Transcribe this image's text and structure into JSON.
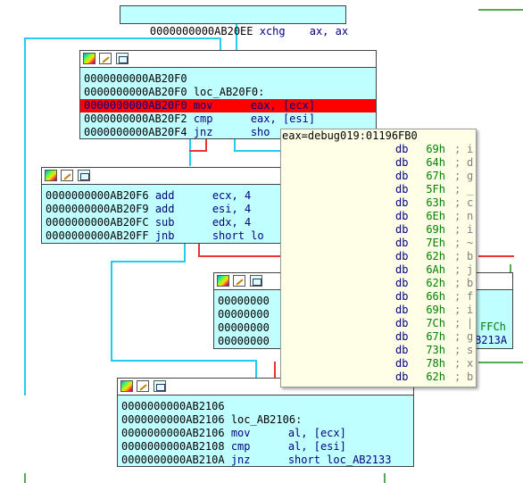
{
  "block_top": {
    "addr": "0000000000AB20EE",
    "mnem": "xchg",
    "ops": "ax, ax"
  },
  "block1": {
    "rows": [
      {
        "addr": "0000000000AB20F0",
        "mnem": "",
        "ops": ""
      },
      {
        "addr": "0000000000AB20F0",
        "mnem": "loc_AB20F0:",
        "ops": ""
      },
      {
        "addr": "0000000000AB20F0",
        "mnem": "mov",
        "ops": "eax, [ecx]"
      },
      {
        "addr": "0000000000AB20F2",
        "mnem": "cmp",
        "ops": "eax, [esi]"
      },
      {
        "addr": "0000000000AB20F4",
        "mnem": "jnz",
        "ops": "sho"
      }
    ]
  },
  "block2": {
    "rows": [
      {
        "addr": "0000000000AB20F6",
        "mnem": "add",
        "ops": "ecx, 4"
      },
      {
        "addr": "0000000000AB20F9",
        "mnem": "add",
        "ops": "esi, 4"
      },
      {
        "addr": "0000000000AB20FC",
        "mnem": "sub",
        "ops": "edx, 4"
      },
      {
        "addr": "0000000000AB20FF",
        "mnem": "jnb",
        "ops": "short lo"
      }
    ]
  },
  "block3": {
    "rows": [
      "00000000",
      "00000000",
      "00000000",
      "00000000"
    ],
    "right_frag_1": "FFCh",
    "right_frag_2": "B213A"
  },
  "block4": {
    "rows": [
      {
        "addr": "0000000000AB2106",
        "mnem": "",
        "ops": ""
      },
      {
        "addr": "0000000000AB2106",
        "mnem": "loc_AB2106:",
        "ops": ""
      },
      {
        "addr": "0000000000AB2106",
        "mnem": "mov",
        "ops": "al, [ecx]"
      },
      {
        "addr": "0000000000AB2108",
        "mnem": "cmp",
        "ops": "al, [esi]"
      },
      {
        "addr": "0000000000AB210A",
        "mnem": "jnz",
        "ops": "short loc_AB2133"
      }
    ]
  },
  "hint": {
    "title": "eax=debug019:01196FB0",
    "rows": [
      {
        "db": "db",
        "hex": "69h",
        "ch": "i"
      },
      {
        "db": "db",
        "hex": "64h",
        "ch": "d"
      },
      {
        "db": "db",
        "hex": "67h",
        "ch": "g"
      },
      {
        "db": "db",
        "hex": "5Fh",
        "ch": "_"
      },
      {
        "db": "db",
        "hex": "63h",
        "ch": "c"
      },
      {
        "db": "db",
        "hex": "6Eh",
        "ch": "n"
      },
      {
        "db": "db",
        "hex": "69h",
        "ch": "i"
      },
      {
        "db": "db",
        "hex": "7Eh",
        "ch": "~"
      },
      {
        "db": "db",
        "hex": "62h",
        "ch": "b"
      },
      {
        "db": "db",
        "hex": "6Ah",
        "ch": "j"
      },
      {
        "db": "db",
        "hex": "62h",
        "ch": "b"
      },
      {
        "db": "db",
        "hex": "66h",
        "ch": "f"
      },
      {
        "db": "db",
        "hex": "69h",
        "ch": "i"
      },
      {
        "db": "db",
        "hex": "7Ch",
        "ch": "|"
      },
      {
        "db": "db",
        "hex": "67h",
        "ch": "g"
      },
      {
        "db": "db",
        "hex": "73h",
        "ch": "s"
      },
      {
        "db": "db",
        "hex": "78h",
        "ch": "x"
      },
      {
        "db": "db",
        "hex": "62h",
        "ch": "b"
      }
    ]
  },
  "colors": {
    "block_bg": "#c0ffff",
    "selection": "#ff0000",
    "edge_true": "#22ccee",
    "edge_false": "#ee3333",
    "edge_green": "#55aa55",
    "hint_bg": "#ffffe8"
  }
}
